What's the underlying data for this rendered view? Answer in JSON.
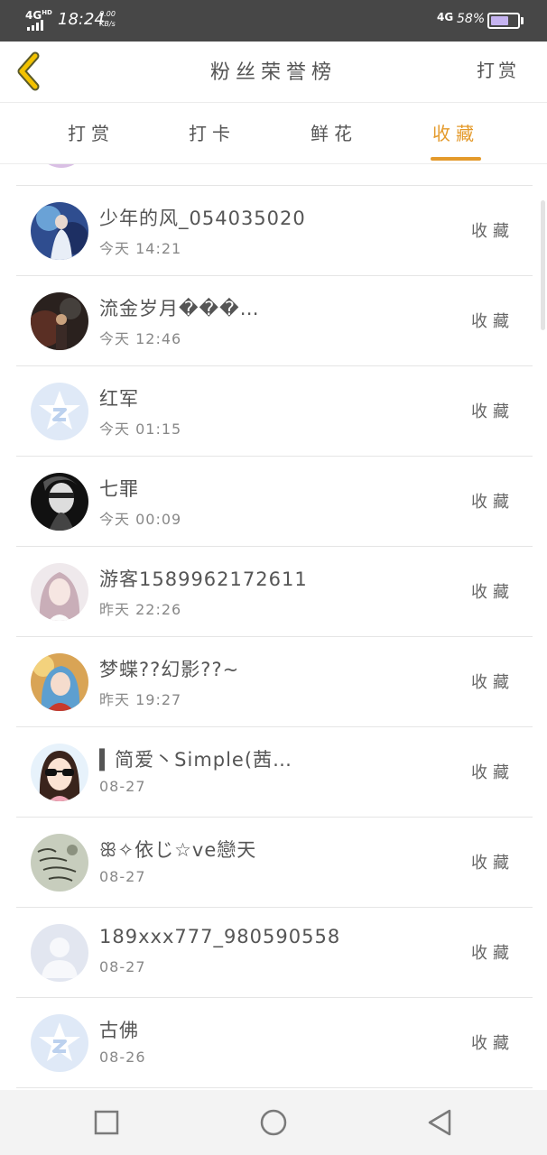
{
  "status_bar": {
    "network": "4G",
    "network_hd": "HD",
    "time": "18:24",
    "speed_value": "0.00",
    "speed_unit": "KB/s",
    "network_right": "4G",
    "battery": "58%"
  },
  "header": {
    "title": "粉丝荣誉榜",
    "right_action": "打赏"
  },
  "tabs": [
    {
      "label": "打赏",
      "active": false
    },
    {
      "label": "打卡",
      "active": false
    },
    {
      "label": "鲜花",
      "active": false
    },
    {
      "label": "收藏",
      "active": true
    }
  ],
  "colors": {
    "accent": "#e49a2b",
    "back_icon": "#f2c200",
    "status_bar_bg": "#474747",
    "nav_bar_bg": "#f3f3f3"
  },
  "entries": [
    {
      "name": "少年的风_054035020",
      "time": "今天 14:21",
      "action": "收藏",
      "avatar": "photo-blue-performer"
    },
    {
      "name": "流金岁月���…",
      "time": "今天 12:46",
      "action": "收藏",
      "avatar": "photo-dark-night"
    },
    {
      "name": "红军",
      "time": "今天 01:15",
      "action": "收藏",
      "avatar": "default-star-avatar"
    },
    {
      "name": "七罪",
      "time": "今天 00:09",
      "action": "收藏",
      "avatar": "photo-dark-portrait"
    },
    {
      "name": "游客1589962172611",
      "time": "昨天 22:26",
      "action": "收藏",
      "avatar": "photo-girl-light"
    },
    {
      "name": "梦蝶??幻影??~",
      "time": "昨天 19:27",
      "action": "收藏",
      "avatar": "anime-girl"
    },
    {
      "name": "▍简爱丶Simple(茜…",
      "time": "08-27",
      "action": "收藏",
      "avatar": "cartoon-girl-glasses"
    },
    {
      "name": "ꕥ✧依じ☆ve戀天",
      "time": "08-27",
      "action": "收藏",
      "avatar": "handwriting-card"
    },
    {
      "name": "189xxx777_980590558",
      "time": "08-27",
      "action": "收藏",
      "avatar": "default-person-avatar"
    },
    {
      "name": "古佛",
      "time": "08-26",
      "action": "收藏",
      "avatar": "default-star-avatar"
    }
  ],
  "nav_bar": {
    "recent": "square-icon",
    "home": "circle-icon",
    "back": "triangle-back-icon"
  }
}
